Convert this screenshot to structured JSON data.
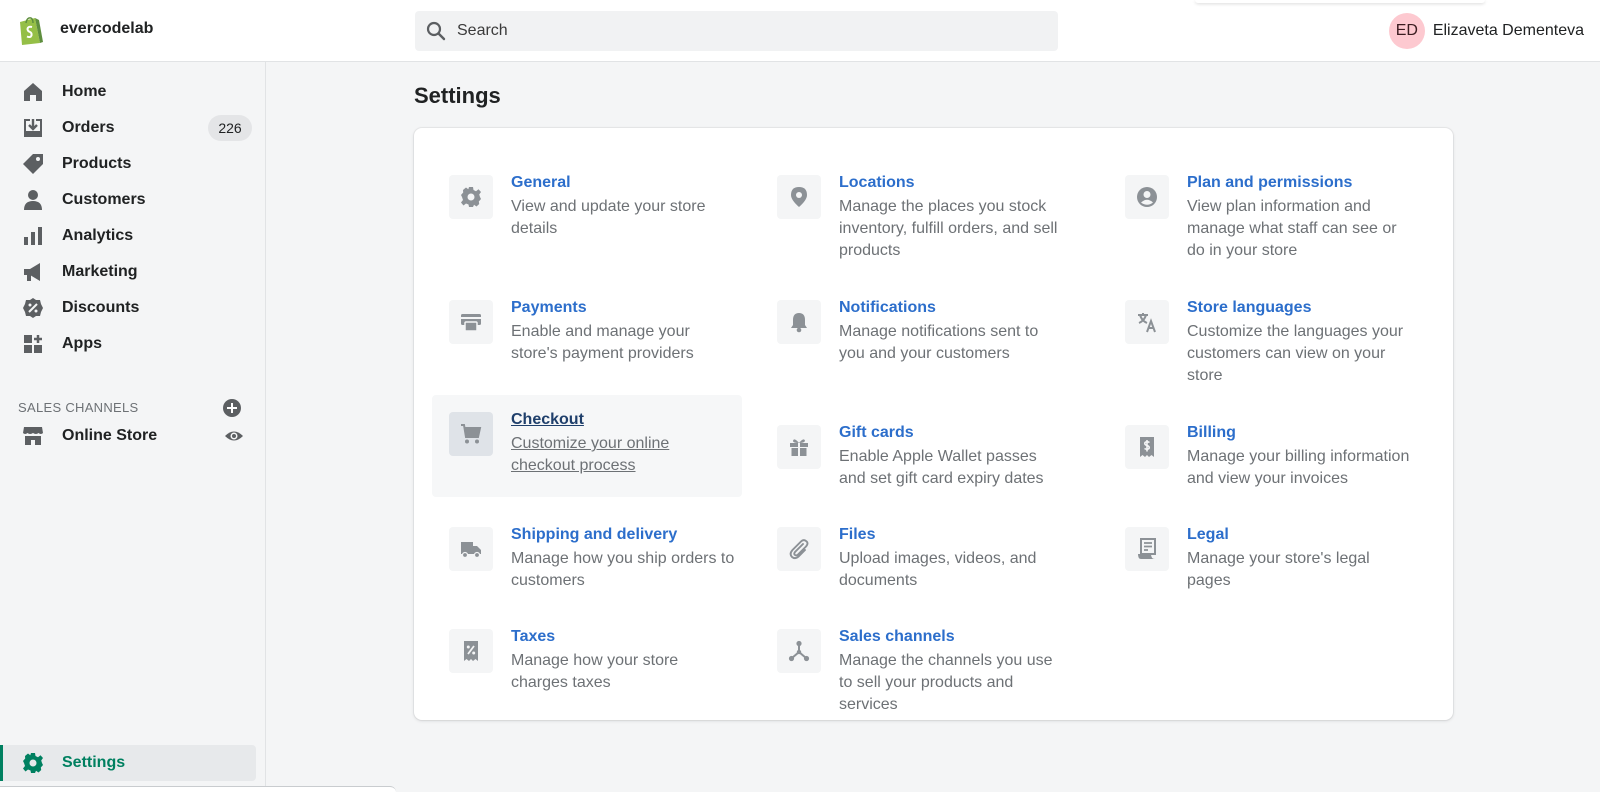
{
  "store": {
    "name": "evercodelab"
  },
  "search": {
    "placeholder": "Search"
  },
  "user": {
    "initials": "ED",
    "name": "Elizaveta Dementeva"
  },
  "sidebar": {
    "items": [
      {
        "label": "Home",
        "icon": "home-icon"
      },
      {
        "label": "Orders",
        "icon": "orders-icon",
        "badge": "226"
      },
      {
        "label": "Products",
        "icon": "tag-icon"
      },
      {
        "label": "Customers",
        "icon": "person-icon"
      },
      {
        "label": "Analytics",
        "icon": "bar-chart-icon"
      },
      {
        "label": "Marketing",
        "icon": "megaphone-icon"
      },
      {
        "label": "Discounts",
        "icon": "discount-icon"
      },
      {
        "label": "Apps",
        "icon": "apps-icon"
      }
    ],
    "sales_channels_label": "SALES CHANNELS",
    "channels": [
      {
        "label": "Online Store",
        "icon": "store-icon"
      }
    ],
    "settings_label": "Settings"
  },
  "page": {
    "title": "Settings"
  },
  "colors": {
    "accent": "#008060",
    "link": "#2c6ecb",
    "avatar_bg": "#fdc9d0"
  },
  "settings_tiles": [
    {
      "title": "General",
      "desc": "View and update your store details",
      "icon": "gear-icon"
    },
    {
      "title": "Locations",
      "desc": "Manage the places you stock inventory, fulfill orders, and sell products",
      "icon": "location-pin-icon"
    },
    {
      "title": "Plan and permissions",
      "desc": "View plan information and manage what staff can see or do in your store",
      "icon": "account-icon"
    },
    {
      "title": "Payments",
      "desc": "Enable and manage your store's payment providers",
      "icon": "payment-card-icon"
    },
    {
      "title": "Notifications",
      "desc": "Manage notifications sent to you and your customers",
      "icon": "bell-icon"
    },
    {
      "title": "Store languages",
      "desc": "Customize the languages your customers can view on your store",
      "icon": "translate-icon"
    },
    {
      "title": "Checkout",
      "desc": "Customize your online checkout process",
      "icon": "cart-icon"
    },
    {
      "title": "Gift cards",
      "desc": "Enable Apple Wallet passes and set gift card expiry dates",
      "icon": "gift-icon"
    },
    {
      "title": "Billing",
      "desc": "Manage your billing information and view your invoices",
      "icon": "receipt-dollar-icon"
    },
    {
      "title": "Shipping and delivery",
      "desc": "Manage how you ship orders to customers",
      "icon": "truck-icon"
    },
    {
      "title": "Files",
      "desc": "Upload images, videos, and documents",
      "icon": "paperclip-icon"
    },
    {
      "title": "Legal",
      "desc": "Manage your store's legal pages",
      "icon": "legal-document-icon"
    },
    {
      "title": "Taxes",
      "desc": "Manage how your store charges taxes",
      "icon": "tax-receipt-icon"
    },
    {
      "title": "Sales channels",
      "desc": "Manage the channels you use to sell your products and services",
      "icon": "channels-icon"
    }
  ]
}
